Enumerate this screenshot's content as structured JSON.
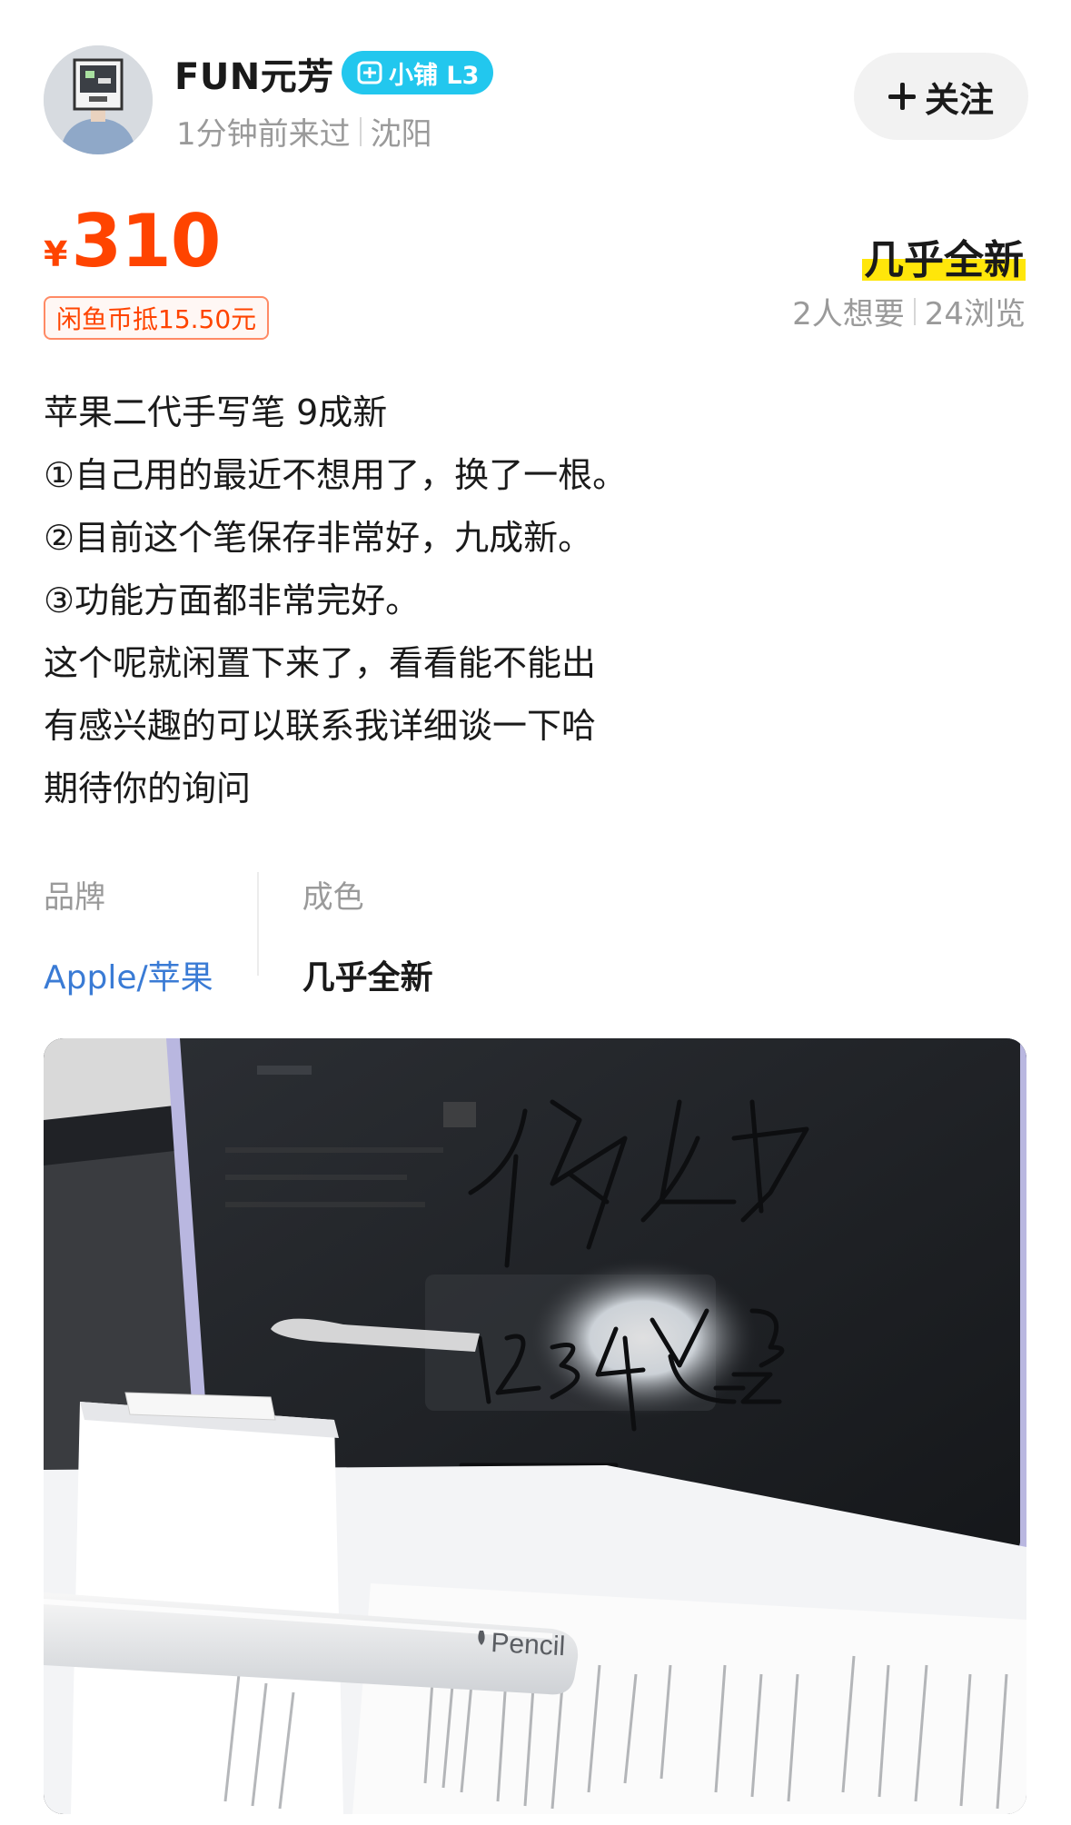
{
  "seller": {
    "name": "FUN元芳",
    "badge": "小铺 L3",
    "last_seen": "1分钟前来过",
    "location": "沈阳",
    "follow_label": "关注"
  },
  "listing": {
    "currency": "¥",
    "price": "310",
    "coin_discount": "闲鱼币抵15.50元",
    "condition": "几乎全新",
    "wants": "2人想要",
    "views": "24浏览"
  },
  "description": [
    "苹果二代手写笔 9成新",
    "①自己用的最近不想用了，换了一根。",
    "②目前这个笔保存非常好，九成新。",
    "③功能方面都非常完好。",
    "这个呢就闲置下来了，看看能不能出",
    "有感兴趣的可以联系我详细谈一下哈",
    "期待你的询问"
  ],
  "attributes": [
    {
      "label": "品牌",
      "value": "Apple/苹果"
    },
    {
      "label": "成色",
      "value": "几乎全新"
    }
  ],
  "photo": {
    "pencil_text": "Pencil",
    "handwriting": "你好",
    "handwriting_line2": "1234 卡 CD 22",
    "colors": {
      "accent": "#ff4400",
      "badge": "#22c7ee",
      "highlight": "#ffe60a",
      "link": "#3a7bd5"
    }
  }
}
